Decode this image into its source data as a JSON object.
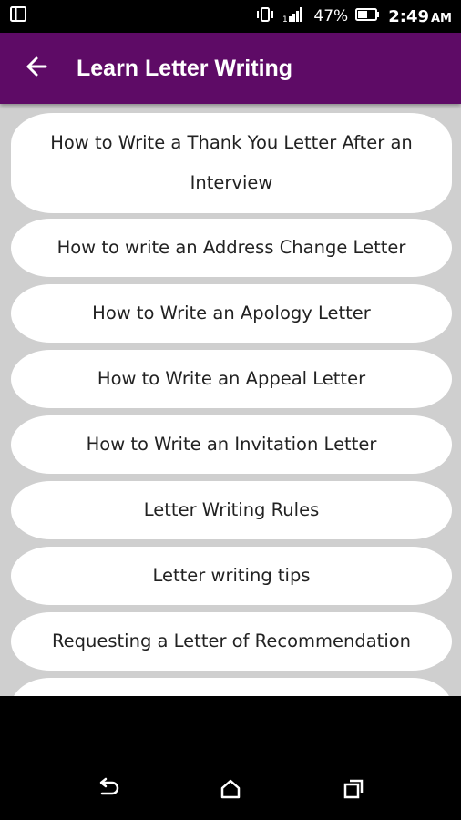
{
  "status_bar": {
    "battery_percent": "47%",
    "time": "2:49",
    "ampm": "AM",
    "icons": [
      "screenshot-icon",
      "vibrate-icon",
      "signal-icon",
      "battery-icon"
    ]
  },
  "app_bar": {
    "title": "Learn Letter Writing",
    "back_icon": "arrow-left-icon",
    "background": "#5e0b66"
  },
  "list": {
    "items": [
      {
        "label": "How to Write a Thank You Letter After an Interview"
      },
      {
        "label": "How to write an Address Change Letter"
      },
      {
        "label": "How to Write an Apology Letter"
      },
      {
        "label": "How to Write an Appeal Letter"
      },
      {
        "label": "How to Write an Invitation Letter"
      },
      {
        "label": "Letter Writing Rules"
      },
      {
        "label": "Letter writing tips"
      },
      {
        "label": "Requesting a Letter of Recommendation"
      }
    ]
  },
  "nav_bar": {
    "icons": [
      "back-icon",
      "home-icon",
      "recents-icon"
    ]
  }
}
